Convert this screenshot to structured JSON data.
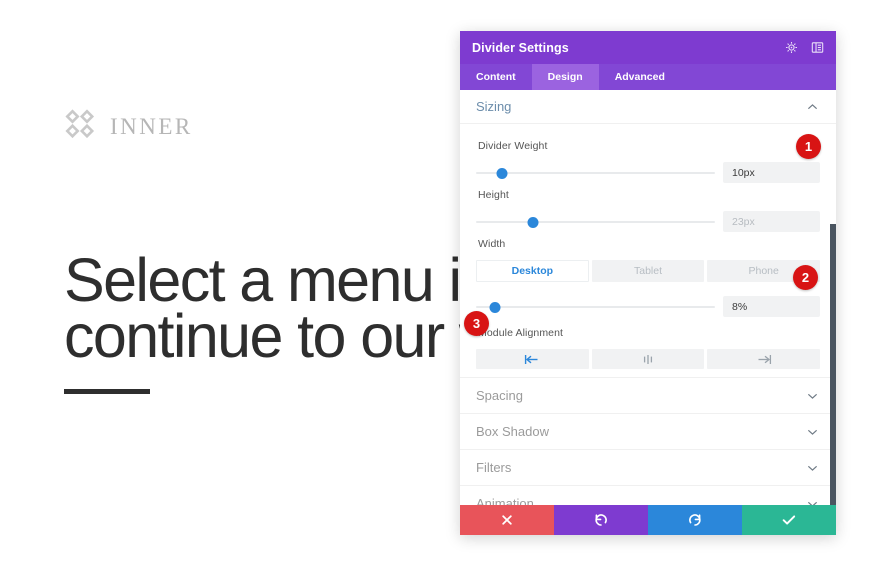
{
  "website": {
    "logo_icon": "four-diamond-logo-icon",
    "logo_text": "INNER",
    "heading_line1": "Select a menu it",
    "heading_line2": "continue to our w",
    "divider": "short-horizontal-rule"
  },
  "panel": {
    "title": "Divider Settings",
    "titlebar_icons": [
      {
        "name": "help-icon",
        "label": "Help"
      },
      {
        "name": "panel-layout-icon",
        "label": "Toggle panel position"
      }
    ],
    "tabs": [
      {
        "label": "Content",
        "active": false
      },
      {
        "label": "Design",
        "active": true
      },
      {
        "label": "Advanced",
        "active": false
      }
    ],
    "sizing": {
      "label": "Sizing",
      "expanded": true,
      "chevron": "chevron-up-icon",
      "fields": [
        {
          "label": "Divider Weight",
          "value": "10px",
          "placeholder": "10px",
          "is_placeholder": false,
          "slider_percent": 11
        },
        {
          "label": "Height",
          "value": "23px",
          "placeholder": "23px",
          "is_placeholder": true,
          "slider_percent": 24
        }
      ],
      "width": {
        "label": "Width",
        "devices": [
          {
            "label": "Desktop",
            "active": true
          },
          {
            "label": "Tablet",
            "active": false
          },
          {
            "label": "Phone",
            "active": false
          }
        ],
        "value": "8%",
        "placeholder": "8%",
        "is_placeholder": false,
        "slider_percent": 8
      },
      "module_alignment": {
        "label": "Module Alignment",
        "options": [
          {
            "name": "align-left-icon",
            "label": "Left",
            "active": true
          },
          {
            "name": "align-center-icon",
            "label": "Center",
            "active": false
          },
          {
            "name": "align-right-icon",
            "label": "Right",
            "active": false
          }
        ]
      }
    },
    "collapsed_sections": [
      {
        "label": "Spacing",
        "chevron": "chevron-down-icon"
      },
      {
        "label": "Box Shadow",
        "chevron": "chevron-down-icon"
      },
      {
        "label": "Filters",
        "chevron": "chevron-down-icon"
      },
      {
        "label": "Animation",
        "chevron": "chevron-down-icon"
      }
    ],
    "actions": [
      {
        "name": "cancel-button",
        "icon": "close-icon",
        "color": "#e8545a"
      },
      {
        "name": "undo-button",
        "icon": "undo-icon",
        "color": "#7e3bd0"
      },
      {
        "name": "redo-button",
        "icon": "redo-icon",
        "color": "#2b87da"
      },
      {
        "name": "save-button",
        "icon": "check-icon",
        "color": "#2bb795"
      }
    ],
    "scrollbar": {
      "name": "panel-scrollbar",
      "color": "#4a5560"
    }
  },
  "badges": [
    {
      "number": "1"
    },
    {
      "number": "2"
    },
    {
      "number": "3"
    }
  ],
  "colors": {
    "titlebar_purple": "#7e3bd0",
    "tabbar_purple": "#8247d5",
    "active_tab_purple": "#9b63e0",
    "slider_blue": "#2b87da",
    "badge_red": "#d81414"
  }
}
